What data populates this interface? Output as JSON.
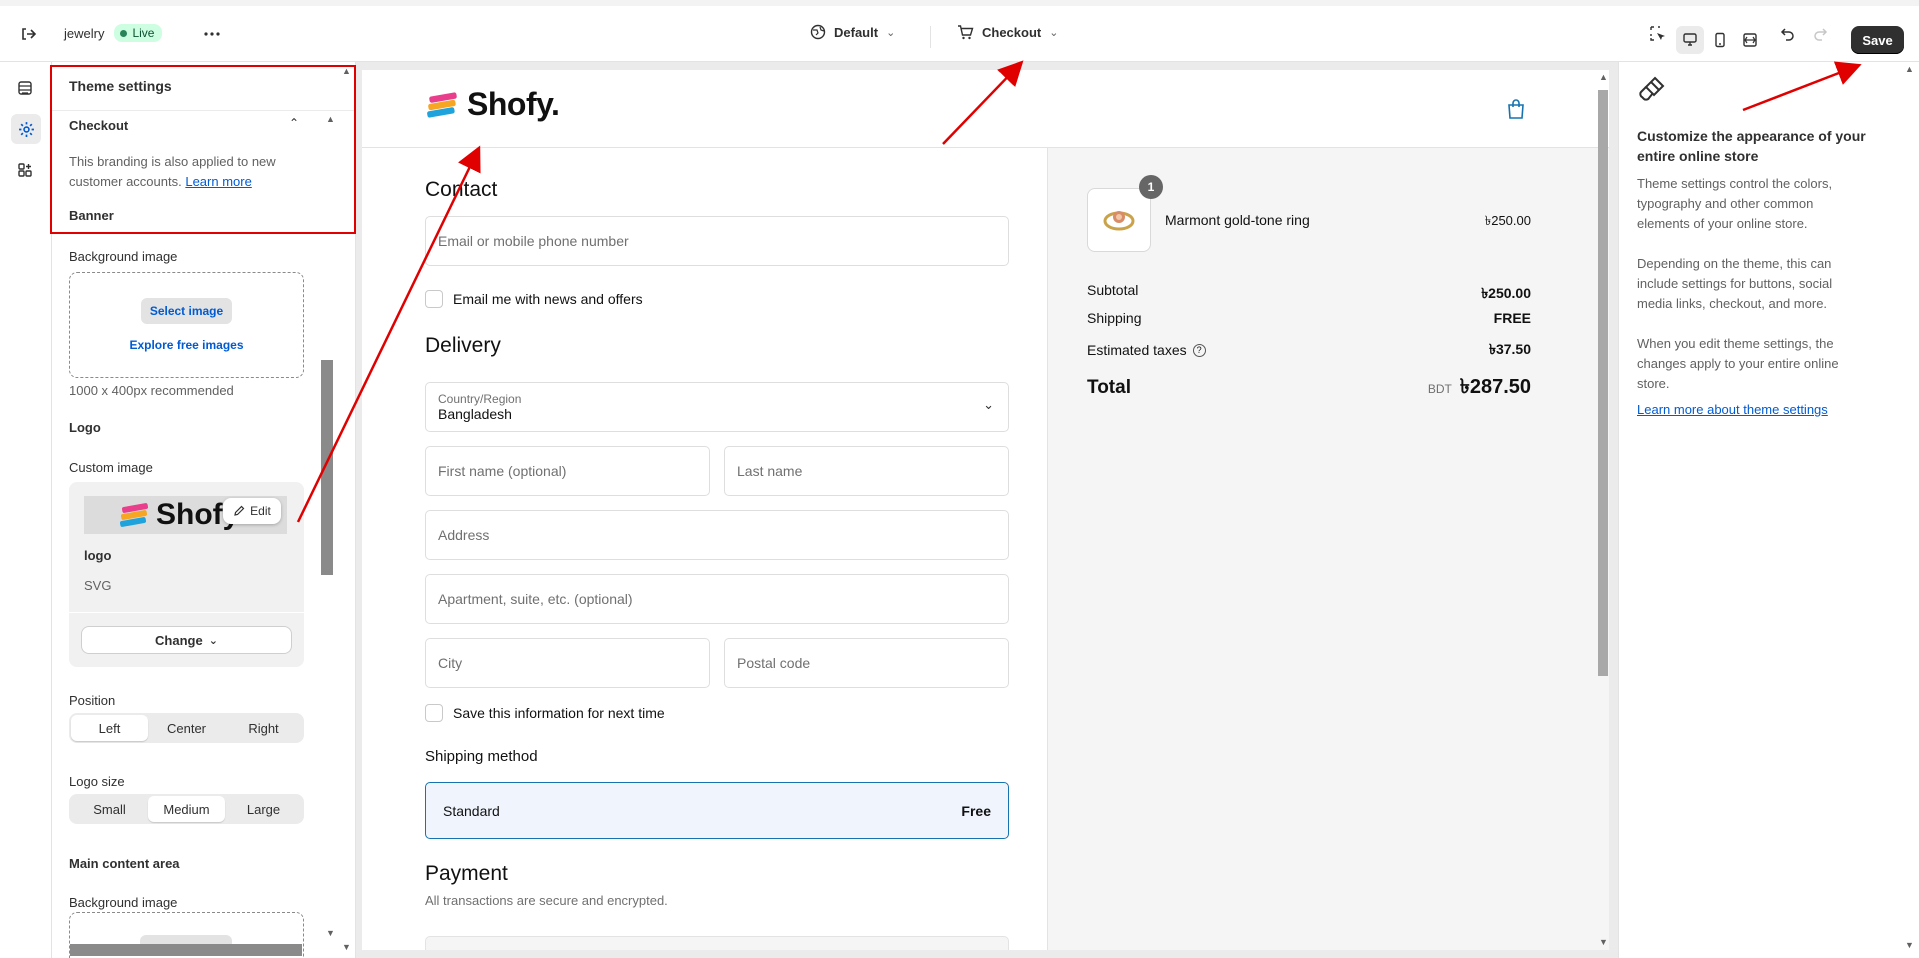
{
  "colors": {
    "accent": "#005bd3",
    "annotation_red": "#e00000",
    "live_bg": "#cdfee1",
    "save_bg": "#303030"
  },
  "topbar": {
    "store_name": "jewelry",
    "live_badge": "Live",
    "theme_selector": "Default",
    "page_selector": "Checkout",
    "save_label": "Save",
    "icons": [
      "exit-icon",
      "more-icon",
      "globe-icon",
      "cart-icon",
      "inspector-icon",
      "desktop-icon",
      "mobile-icon",
      "fullwidth-icon",
      "undo-icon",
      "redo-icon"
    ]
  },
  "rail": {
    "icons": [
      "sections-icon",
      "settings-icon",
      "apps-icon"
    ]
  },
  "panel": {
    "title": "Theme settings",
    "section": "Checkout",
    "description": "This branding is also applied to new customer accounts.",
    "learn_more": "Learn more",
    "banner_heading": "Banner",
    "bg_image_label": "Background image",
    "select_image": "Select image",
    "explore_images": "Explore free images",
    "bg_hint": "1000 x 400px recommended",
    "logo_heading": "Logo",
    "custom_image_label": "Custom image",
    "edit_label": "Edit",
    "file_name": "logo",
    "file_type": "SVG",
    "change_label": "Change",
    "position_label": "Position",
    "position_options": [
      "Left",
      "Center",
      "Right"
    ],
    "position_selected": "Left",
    "logo_size_label": "Logo size",
    "logo_size_options": [
      "Small",
      "Medium",
      "Large"
    ],
    "logo_size_selected": "Medium",
    "main_content_heading": "Main content area",
    "main_bg_label": "Background image"
  },
  "preview": {
    "brand": "Shofy.",
    "contact_heading": "Contact",
    "email_placeholder": "Email or mobile phone number",
    "email_optin": "Email me with news and offers",
    "delivery_heading": "Delivery",
    "country_label": "Country/Region",
    "country_value": "Bangladesh",
    "first_name": "First name (optional)",
    "last_name": "Last name",
    "address": "Address",
    "apartment": "Apartment, suite, etc. (optional)",
    "city": "City",
    "postal": "Postal code",
    "save_info": "Save this information for next time",
    "shipping_method_heading": "Shipping method",
    "shipping_option": "Standard",
    "shipping_option_price": "Free",
    "payment_heading": "Payment",
    "payment_note": "All transactions are secure and encrypted.",
    "summary": {
      "item_name": "Marmont gold-tone ring",
      "item_price": "৳250.00",
      "item_qty": "1",
      "subtotal_label": "Subtotal",
      "subtotal_value": "৳250.00",
      "shipping_label": "Shipping",
      "shipping_value": "FREE",
      "taxes_label": "Estimated taxes",
      "taxes_value": "৳37.50",
      "total_label": "Total",
      "currency": "BDT",
      "total_value": "৳287.50"
    }
  },
  "help": {
    "title": "Customize the appearance of your entire online store",
    "p1": "Theme settings control the colors, typography and other common elements of your online store.",
    "p2": "Depending on the theme, this can include settings for buttons, social media links, checkout, and more.",
    "p3": "When you edit theme settings, the changes apply to your entire online store.",
    "link": "Learn more about theme settings"
  }
}
